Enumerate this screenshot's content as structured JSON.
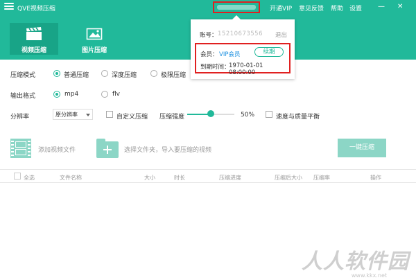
{
  "app": {
    "title": "QVE视频压缩"
  },
  "nav": {
    "vip": "开通VIP",
    "feedback": "意见反馈",
    "help": "帮助",
    "settings": "设置"
  },
  "window_controls": {
    "minimize": "—",
    "close": "✕"
  },
  "tabs": [
    {
      "label": "视频压缩",
      "icon": "clapper-icon",
      "active": true
    },
    {
      "label": "图片压缩",
      "icon": "image-icon",
      "active": false
    }
  ],
  "account_popup": {
    "account_label": "账号：",
    "account_value": "15210673556",
    "logout": "退出",
    "member_label": "会员：",
    "member_value": "VIP会员",
    "renew_label": "续期",
    "expire_label": "到期时间：",
    "expire_value": "1970-01-01 08:00:00"
  },
  "compress_mode": {
    "label": "压缩模式",
    "options": [
      "普通压缩",
      "深度压缩",
      "极限压缩"
    ],
    "selected": "普通压缩"
  },
  "output_format": {
    "label": "输出格式",
    "options": [
      "mp4",
      "flv"
    ],
    "selected": "mp4"
  },
  "resolution": {
    "label": "分辨率",
    "value": "原分辨率",
    "custom_label": "自定义压缩",
    "strength_label": "压缩强度",
    "strength_value": "50%",
    "strength_fraction": 0.5,
    "balance_label": "速度与质量平衡"
  },
  "actions": {
    "add_video": "添加视频文件",
    "select_folder": "选择文件夹，导入要压缩的视频",
    "compress_all": "一键压缩"
  },
  "table": {
    "select_all": "全选",
    "columns": [
      "文件名称",
      "大小",
      "时长",
      "压缩进度",
      "压缩后大小",
      "压缩率",
      "操作"
    ]
  },
  "watermark": {
    "text": "人人软件园",
    "url": "www.kkx.net"
  },
  "colors": {
    "accent": "#21b99a",
    "accent_dark": "#18a487",
    "highlight": "#e02020",
    "link": "#1a8fe0"
  }
}
